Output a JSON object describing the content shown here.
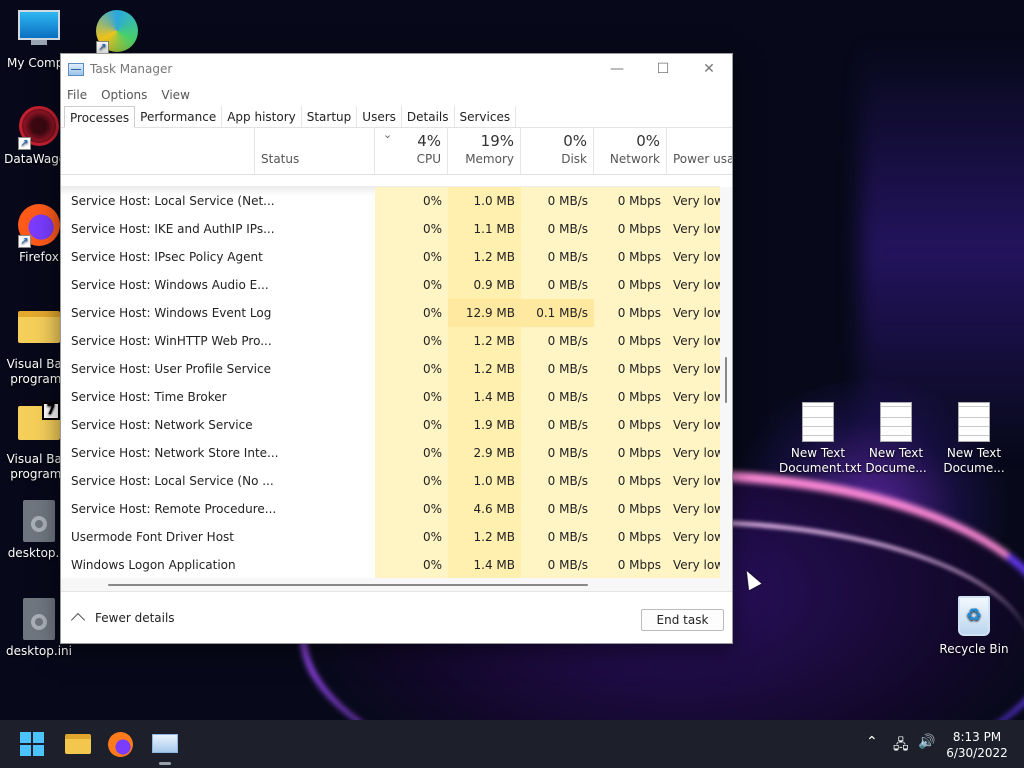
{
  "window": {
    "title": "Task Manager",
    "menu": [
      "File",
      "Options",
      "View"
    ],
    "tabs": [
      "Processes",
      "Performance",
      "App history",
      "Startup",
      "Users",
      "Details",
      "Services"
    ],
    "active_tab": "Processes",
    "columns": {
      "status": {
        "label": "Status"
      },
      "cpu": {
        "pct": "4%",
        "label": "CPU"
      },
      "memory": {
        "pct": "19%",
        "label": "Memory"
      },
      "disk": {
        "pct": "0%",
        "label": "Disk"
      },
      "network": {
        "pct": "0%",
        "label": "Network"
      },
      "power": {
        "label": "Power usag"
      }
    },
    "rows": [
      {
        "name": "Service Host: Local Service (Net...",
        "cpu": "0%",
        "memory": "1.0 MB",
        "disk": "0 MB/s",
        "network": "0 Mbps",
        "power": "Very low"
      },
      {
        "name": "Service Host: IKE and AuthIP IPs...",
        "cpu": "0%",
        "memory": "1.1 MB",
        "disk": "0 MB/s",
        "network": "0 Mbps",
        "power": "Very low"
      },
      {
        "name": "Service Host: IPsec Policy Agent",
        "cpu": "0%",
        "memory": "1.2 MB",
        "disk": "0 MB/s",
        "network": "0 Mbps",
        "power": "Very low"
      },
      {
        "name": "Service Host: Windows Audio E...",
        "cpu": "0%",
        "memory": "0.9 MB",
        "disk": "0 MB/s",
        "network": "0 Mbps",
        "power": "Very low"
      },
      {
        "name": "Service Host: Windows Event Log",
        "cpu": "0%",
        "memory": "12.9 MB",
        "disk": "0.1 MB/s",
        "network": "0 Mbps",
        "power": "Very low"
      },
      {
        "name": "Service Host: WinHTTP Web Pro...",
        "cpu": "0%",
        "memory": "1.2 MB",
        "disk": "0 MB/s",
        "network": "0 Mbps",
        "power": "Very low"
      },
      {
        "name": "Service Host: User Profile Service",
        "cpu": "0%",
        "memory": "1.2 MB",
        "disk": "0 MB/s",
        "network": "0 Mbps",
        "power": "Very low"
      },
      {
        "name": "Service Host: Time Broker",
        "cpu": "0%",
        "memory": "1.4 MB",
        "disk": "0 MB/s",
        "network": "0 Mbps",
        "power": "Very low"
      },
      {
        "name": "Service Host: Network Service",
        "cpu": "0%",
        "memory": "1.9 MB",
        "disk": "0 MB/s",
        "network": "0 Mbps",
        "power": "Very low"
      },
      {
        "name": "Service Host: Network Store Inte...",
        "cpu": "0%",
        "memory": "2.9 MB",
        "disk": "0 MB/s",
        "network": "0 Mbps",
        "power": "Very low"
      },
      {
        "name": "Service Host: Local Service (No ...",
        "cpu": "0%",
        "memory": "1.0 MB",
        "disk": "0 MB/s",
        "network": "0 Mbps",
        "power": "Very low"
      },
      {
        "name": "Service Host: Remote Procedure...",
        "cpu": "0%",
        "memory": "4.6 MB",
        "disk": "0 MB/s",
        "network": "0 Mbps",
        "power": "Very low"
      },
      {
        "name": "Usermode Font Driver Host",
        "cpu": "0%",
        "memory": "1.2 MB",
        "disk": "0 MB/s",
        "network": "0 Mbps",
        "power": "Very low"
      },
      {
        "name": "Windows Logon Application",
        "cpu": "0%",
        "memory": "1.4 MB",
        "disk": "0 MB/s",
        "network": "0 Mbps",
        "power": "Very low"
      }
    ],
    "footer": {
      "fewer_details": "Fewer details",
      "end_task": "End task"
    }
  },
  "desktop": {
    "icons": [
      {
        "label": "My Compu",
        "icon": "computer-icon"
      },
      {
        "label": "DataWagon",
        "icon": "datawagon-icon"
      },
      {
        "label": "Firefox",
        "icon": "firefox-icon"
      },
      {
        "label": "Visual Basi programs",
        "icon": "folder-icon"
      },
      {
        "label": "Visual Basi programs",
        "icon": "archive-icon"
      },
      {
        "label": "desktop.in",
        "icon": "settings-file-icon"
      },
      {
        "label": "desktop.ini",
        "icon": "settings-file-icon"
      },
      {
        "label": "New Text Document.txt",
        "icon": "text-file-icon"
      },
      {
        "label": "New Text Docume...",
        "icon": "text-file-icon"
      },
      {
        "label": "New Text Docume...",
        "icon": "text-file-icon"
      },
      {
        "label": "Recycle Bin",
        "icon": "recycle-bin-icon"
      }
    ]
  },
  "taskbar": {
    "time": "8:13 PM",
    "date": "6/30/2022"
  },
  "colors": {
    "accent": "#4cc2ff",
    "cpu_heat": "#fff4c4",
    "mem_heat": "#fff0b0"
  }
}
